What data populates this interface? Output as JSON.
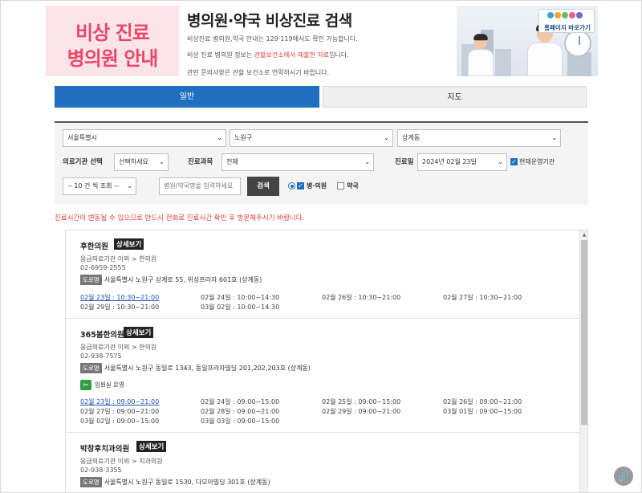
{
  "banner": {
    "left_line1": "비상 진료",
    "left_line2": "병의원 안내",
    "title": "병의원·약국 비상진료 검색",
    "line1": "비상진료 병의원,약국 안내는 129·119에서도 확인 가능합니다.",
    "line2_pre": "비상 진료 병의원 정보는 ",
    "line2_red": "관할보건소에서 제출한 자료",
    "line2_post": "입니다.",
    "line3": "관련 문의사항은 관할 보건소로 연락하시기 바랍니다.",
    "home_button": "홈페이지 바로가기"
  },
  "tabs": [
    {
      "label": "일반",
      "active": true
    },
    {
      "label": "지도",
      "active": false
    }
  ],
  "filters": {
    "city": "서울특별시",
    "district": "노원구",
    "dong": "상계동",
    "institution_label": "의료기관 선택",
    "institution_value": "선택하세요",
    "dept_label": "진료과목",
    "dept_value": "전체",
    "date_label": "진료일",
    "date_value": "2024년 02월 23일",
    "open_now_label": "현재운영기관",
    "per_page": "-- 10 건 씩 조회 --",
    "search_placeholder": "병원/약국명을 입력하세요",
    "search_button": "검색",
    "opt_hospital": "병·의원",
    "opt_pharmacy": "약국"
  },
  "notice": "진료시간이 변동될 수 있으므로 반드시 전화로 진료시간 확인 후 방문해주시기 바랍니다.",
  "detail_label": "상세보기",
  "road_tag": "도로명",
  "results": [
    {
      "name": "후한의원",
      "category": "응급의료기관 이외 > 한의원",
      "phone": "02-6959-2555",
      "address": "서울특별시 노원구 상계로 55, 위성프라자 601호 (상계동)",
      "ward": "",
      "hours": [
        "02월 23일 : 10:30~21:00",
        "02월 24일 : 10:00~14:30",
        "02월 26일 : 10:30~21:00",
        "02월 27일 : 10:30~21:00",
        "02월 29일 : 10:30~21:00",
        "03월 02일 : 10:00~14:30"
      ]
    },
    {
      "name": "365봄한의원",
      "category": "응급의료기관 이외 > 한의원",
      "phone": "02-938-7575",
      "address": "서울특별시 노원구 동일로 1343, 동일프라자빌딩 201,202,203호 (상계동)",
      "ward": "입원실 운영",
      "hours": [
        "02월 23일 : 09:00~21:00",
        "02월 24일 : 09:00~15:00",
        "02월 25일 : 09:00~15:00",
        "02월 26일 : 09:00~21:00",
        "02월 27일 : 09:00~21:00",
        "02월 28일 : 09:00~21:00",
        "02월 29일 : 09:00~21:00",
        "03월 01일 : 09:00~15:00",
        "03월 02일 : 09:00~15:00",
        "03월 03일 : 09:00~15:00"
      ]
    },
    {
      "name": "박창후치과의원",
      "category": "응급의료기관 이외 > 치과의원",
      "phone": "02-938-3355",
      "address": "서울특별시 노원구 동일로 1530, 다모아빌딩 301호 (상계동)",
      "ward": "",
      "hours": []
    }
  ]
}
